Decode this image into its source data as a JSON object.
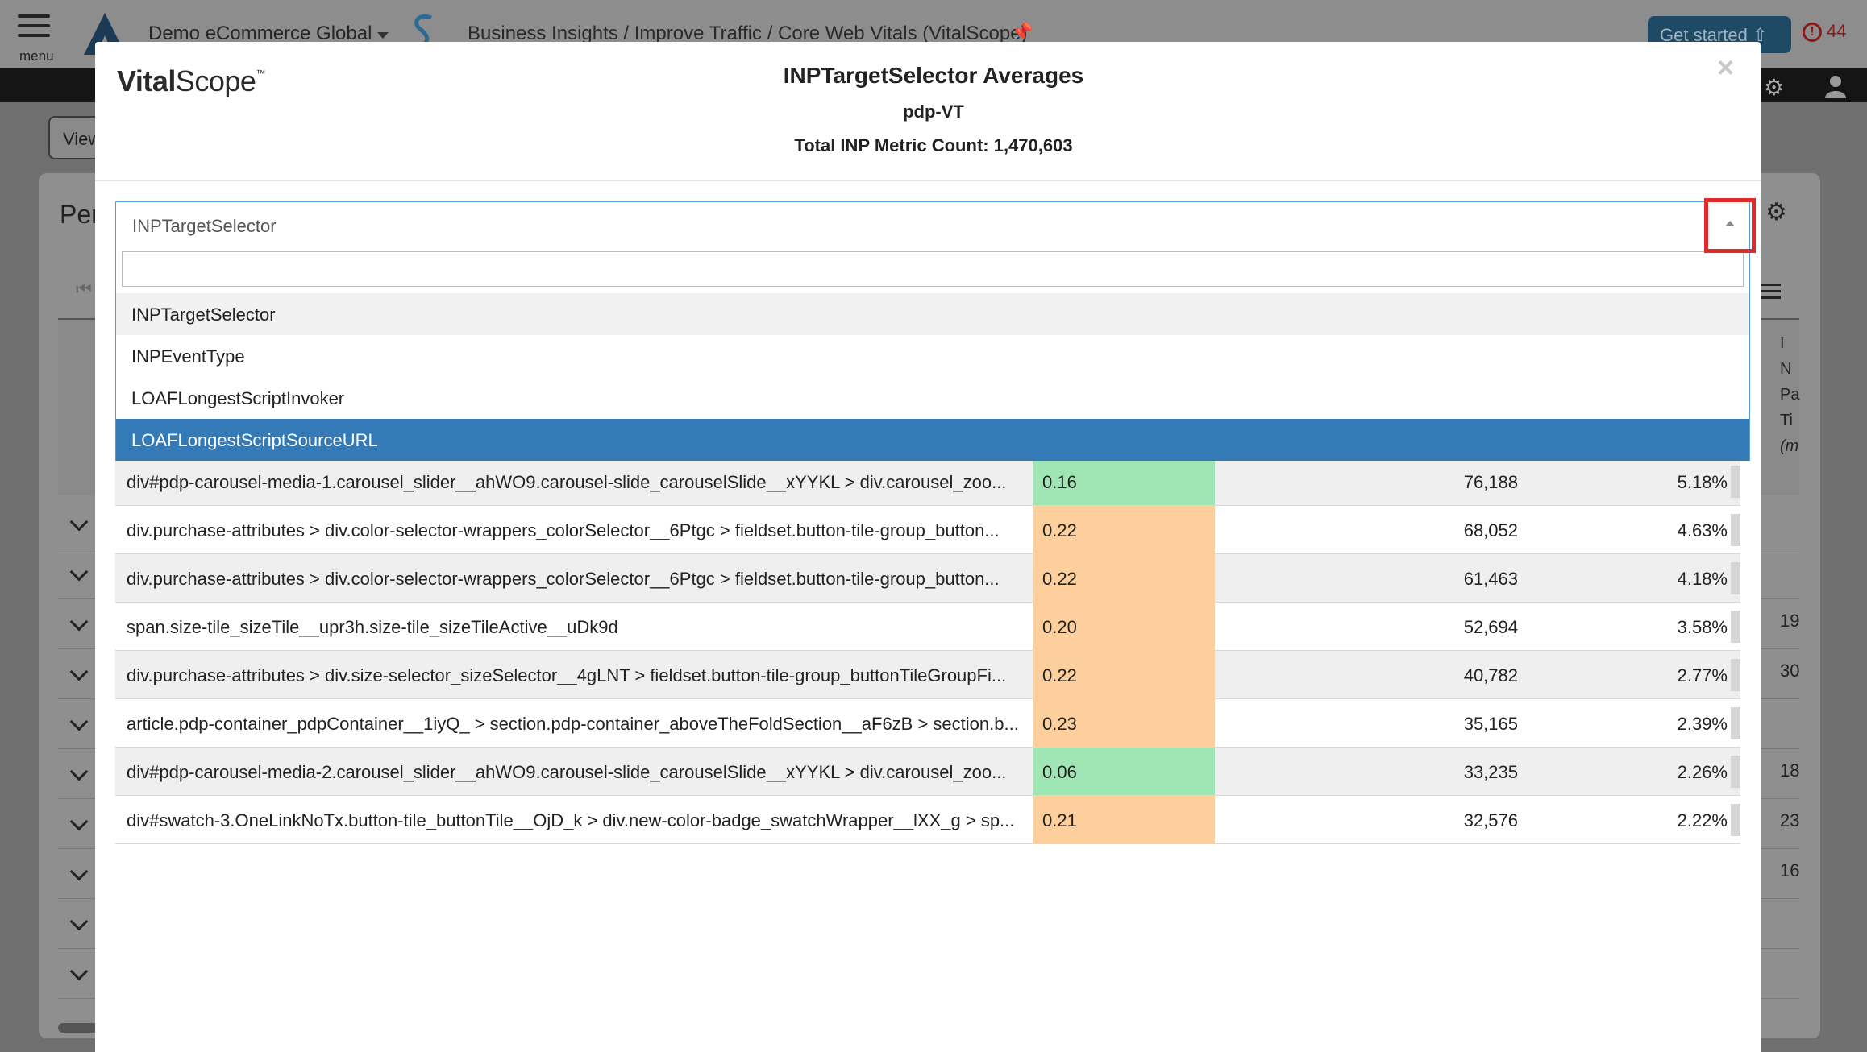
{
  "app": {
    "menu_label": "menu",
    "org_name": "Demo eCommerce Global",
    "breadcrumb": "Business Insights / Improve Traffic / Core Web Vitals (VitalScope)",
    "get_started": "Get started",
    "alert_count": "44",
    "view_button": "View",
    "card_title": "Per",
    "background_column_header": [
      "I",
      "N",
      "Pa",
      "Ti",
      "(m"
    ],
    "background_values": [
      "19",
      "30",
      "18",
      "23",
      "16"
    ]
  },
  "modal": {
    "logo_bold": "Vital",
    "logo_light": "Scope",
    "logo_tm": "™",
    "title": "INPTargetSelector Averages",
    "subtitle": "pdp-VT",
    "total": "Total INP Metric Count: 1,470,603",
    "close": "×",
    "select": {
      "value": "INPTargetSelector",
      "search_value": "",
      "options": [
        {
          "label": "INPTargetSelector",
          "state": "highlighted"
        },
        {
          "label": "INPEventType",
          "state": "normal"
        },
        {
          "label": "LOAFLongestScriptInvoker",
          "state": "normal"
        },
        {
          "label": "LOAFLongestScriptSourceURL",
          "state": "selected"
        }
      ]
    },
    "table": {
      "rows": [
        {
          "selector": "div#pdp-carousel-media-1.carousel_slider__ahWO9.carousel-slide_carouselSlide__xYYKL > div.carousel_zoo...",
          "inp": "0.16",
          "rating": "good",
          "count": "76,188",
          "percent": "5.18%"
        },
        {
          "selector": "div.purchase-attributes > div.color-selector-wrappers_colorSelector__6Ptgc > fieldset.button-tile-group_button...",
          "inp": "0.22",
          "rating": "needs-improvement",
          "count": "68,052",
          "percent": "4.63%"
        },
        {
          "selector": "div.purchase-attributes > div.color-selector-wrappers_colorSelector__6Ptgc > fieldset.button-tile-group_button...",
          "inp": "0.22",
          "rating": "needs-improvement",
          "count": "61,463",
          "percent": "4.18%"
        },
        {
          "selector": "span.size-tile_sizeTile__upr3h.size-tile_sizeTileActive__uDk9d",
          "inp": "0.20",
          "rating": "needs-improvement",
          "count": "52,694",
          "percent": "3.58%"
        },
        {
          "selector": "div.purchase-attributes > div.size-selector_sizeSelector__4gLNT > fieldset.button-tile-group_buttonTileGroupFi...",
          "inp": "0.22",
          "rating": "needs-improvement",
          "count": "40,782",
          "percent": "2.77%"
        },
        {
          "selector": "article.pdp-container_pdpContainer__1iyQ_ > section.pdp-container_aboveTheFoldSection__aF6zB > section.b...",
          "inp": "0.23",
          "rating": "needs-improvement",
          "count": "35,165",
          "percent": "2.39%"
        },
        {
          "selector": "div#pdp-carousel-media-2.carousel_slider__ahWO9.carousel-slide_carouselSlide__xYYKL > div.carousel_zoo...",
          "inp": "0.06",
          "rating": "good",
          "count": "33,235",
          "percent": "2.26%"
        },
        {
          "selector": "div#swatch-3.OneLinkNoTx.button-tile_buttonTile__OjD_k > div.new-color-badge_swatchWrapper__lXX_g > sp...",
          "inp": "0.21",
          "rating": "needs-improvement",
          "count": "32,576",
          "percent": "2.22%"
        }
      ]
    }
  },
  "colors": {
    "selected_option": "#337ab7",
    "good": "#9fe6b4",
    "needs_improvement": "#fdcf9c",
    "highlight_box": "#e12b2b"
  }
}
